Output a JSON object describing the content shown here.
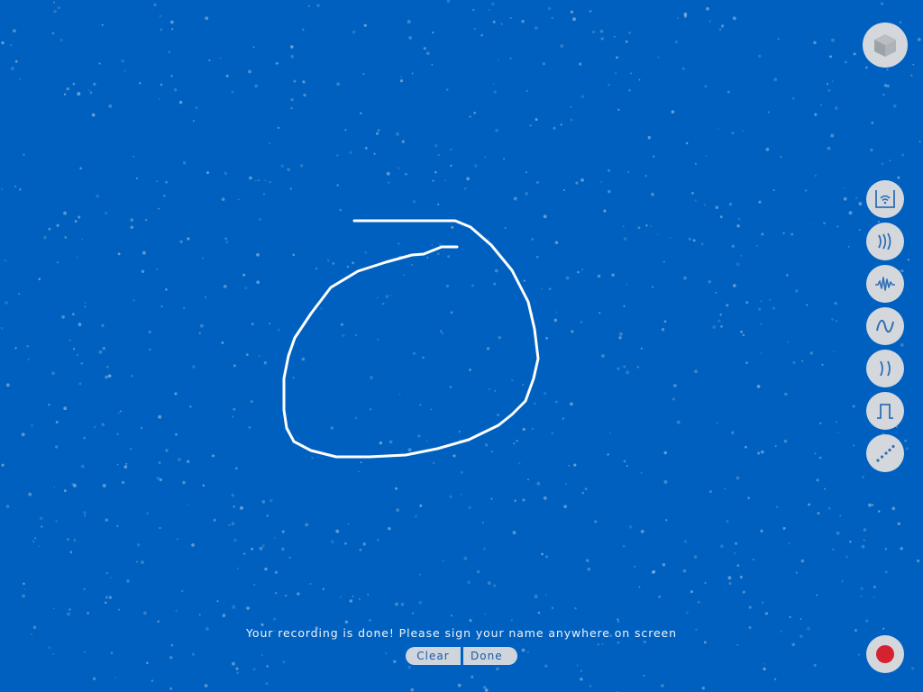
{
  "prompt": {
    "message": "Your recording is done! Please sign your name anywhere on screen"
  },
  "actions": {
    "clear_label": "Clear",
    "done_label": "Done"
  },
  "tools": [
    {
      "icon": "room-wifi-icon"
    },
    {
      "icon": "sound-waves-icon"
    },
    {
      "icon": "noise-wave-icon"
    },
    {
      "icon": "sine-wave-icon"
    },
    {
      "icon": "parentheses-icon"
    },
    {
      "icon": "square-wave-icon"
    },
    {
      "icon": "dotted-line-icon"
    }
  ],
  "colors": {
    "background": "#0060bf",
    "button": "#d4d8dd",
    "icon": "#2f6fb6",
    "record": "#d4232e"
  }
}
